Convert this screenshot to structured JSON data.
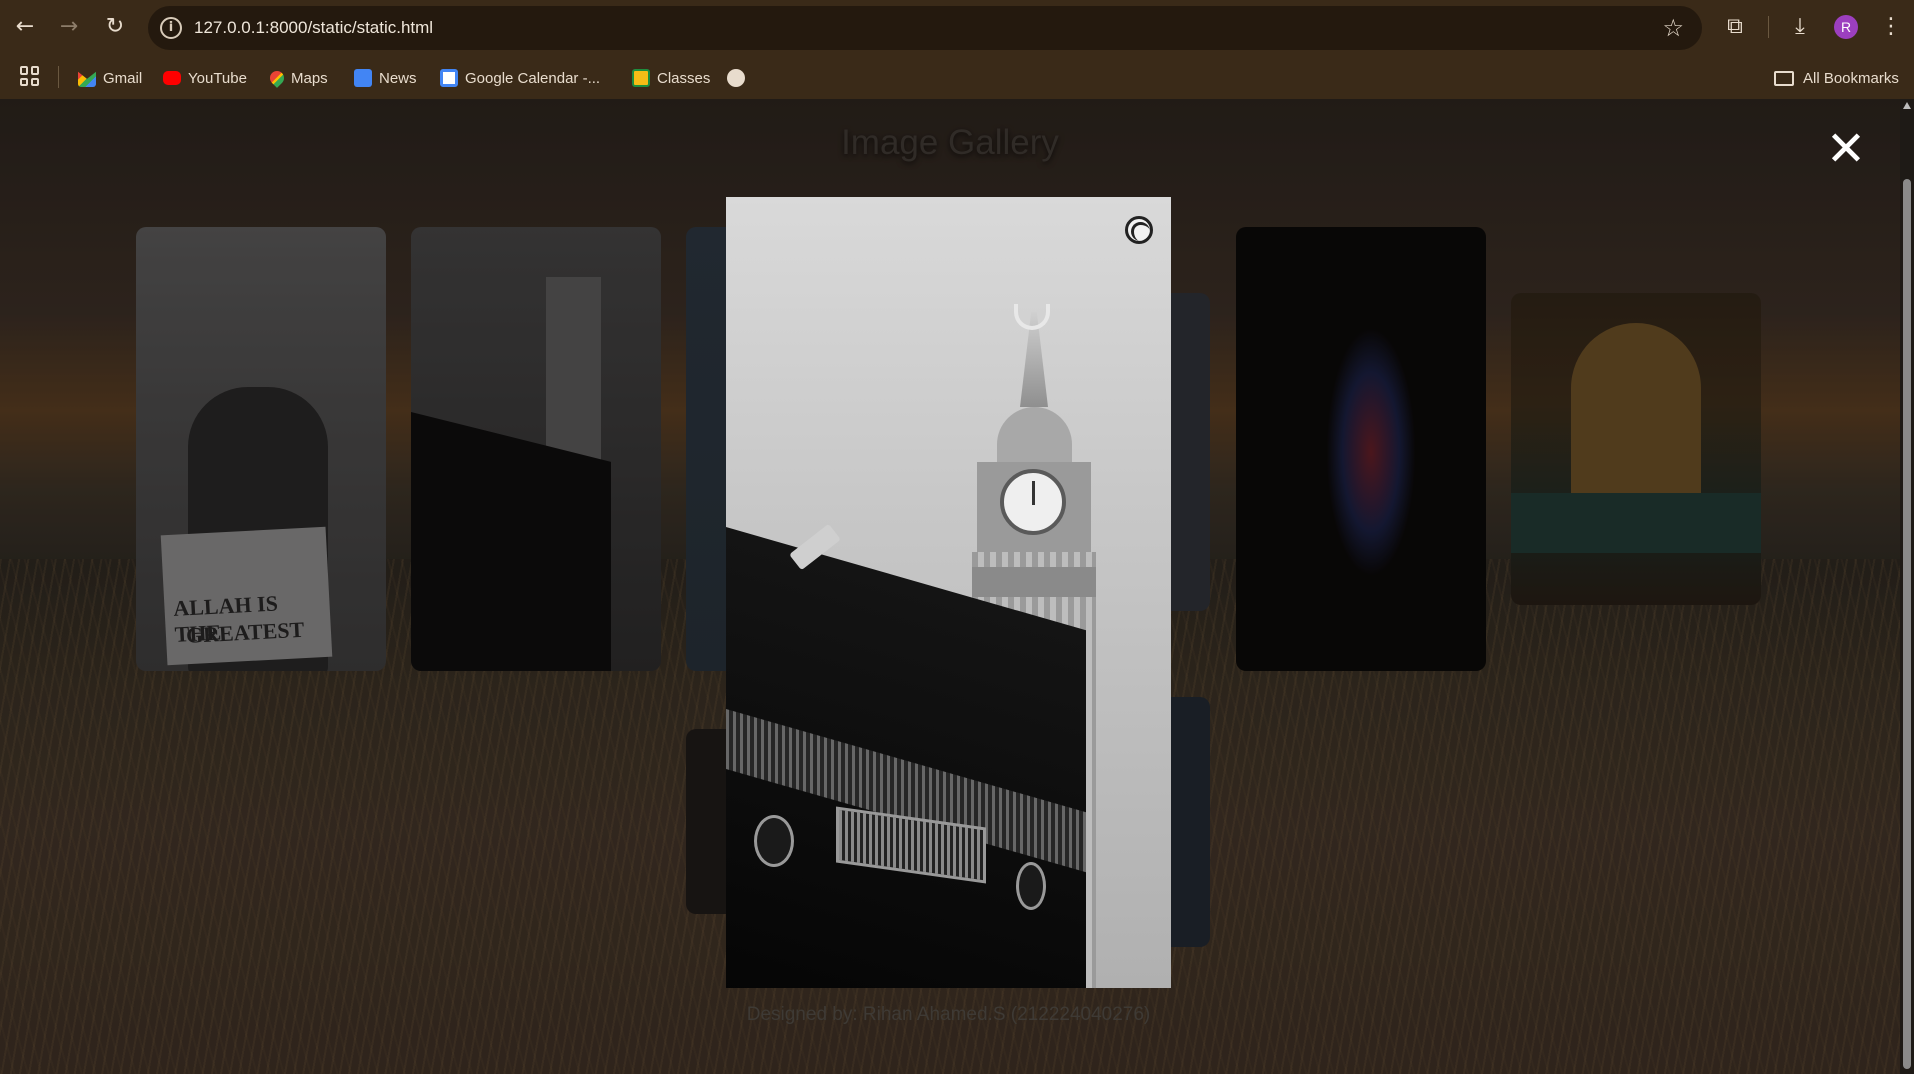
{
  "browser": {
    "url": "127.0.0.1:8000/static/static.html",
    "avatar_letter": "R",
    "icons": {
      "back": "back-arrow-icon",
      "forward": "forward-arrow-icon",
      "reload": "reload-icon",
      "site_info": "info-icon",
      "bookmark_star": "star-icon",
      "extensions": "puzzle-icon",
      "downloads": "download-icon",
      "menu": "kebab-menu-icon"
    },
    "avatar_color": "#9c3fbf"
  },
  "bookmarks": {
    "items": [
      {
        "label": "Gmail",
        "icon": "gmail-icon"
      },
      {
        "label": "YouTube",
        "icon": "youtube-icon"
      },
      {
        "label": "Maps",
        "icon": "maps-icon"
      },
      {
        "label": "News",
        "icon": "news-icon"
      },
      {
        "label": "Google Calendar -...",
        "icon": "calendar-icon"
      },
      {
        "label": "Classes",
        "icon": "classroom-icon"
      },
      {
        "label": "",
        "icon": "globe-icon"
      }
    ],
    "all_bookmarks": "All Bookmarks"
  },
  "page": {
    "title": "Image Gallery",
    "newspaper_text_1": "ALLAH IS THE",
    "newspaper_text_2": "GREATEST",
    "footer_credit": "Designed by: Rihan Ahamed.S (212224040276)",
    "close_symbol": "✕",
    "lightbox_icon": "loading-spinner-icon"
  }
}
